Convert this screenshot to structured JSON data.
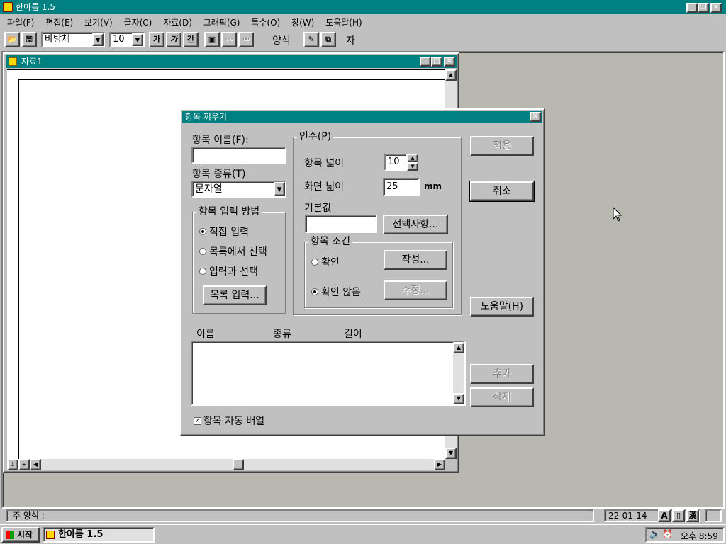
{
  "app": {
    "title": "한아름 1.5",
    "title_icon": "hanarum-app-icon",
    "menu": [
      "파일(F)",
      "편집(E)",
      "보기(V)",
      "글자(C)",
      "자료(D)",
      "그래픽(G)",
      "특수(O)",
      "창(W)",
      "도움말(H)"
    ]
  },
  "toolbar": {
    "font_name": "바탕체",
    "font_size": "10",
    "bold_label": "가",
    "italic_label": "가",
    "underline_label": "간",
    "style_label": "양식",
    "last_label": "자"
  },
  "doc_window": {
    "title": "자료1"
  },
  "dialog": {
    "title": "항목 끼우기",
    "item_name_label": "항목 이름(F):",
    "item_name_value": "",
    "item_type_label": "항목 종류(T)",
    "item_type_value": "문자열",
    "input_method": {
      "legend": "항목 입력 방법",
      "options": [
        "직접 입력",
        "목록에서 선택",
        "입력과 선택"
      ],
      "selected": "직접 입력",
      "list_button": "목록 입력..."
    },
    "args": {
      "legend": "인수(P)",
      "item_width_label": "항목 넓이",
      "item_width_value": "10",
      "screen_width_label": "화면 넓이",
      "screen_width_value": "25",
      "screen_width_unit": "mm",
      "default_label": "기본값",
      "default_value": "",
      "choices_button": "선택사항...",
      "condition": {
        "legend": "항목 조건",
        "confirm_label": "확인",
        "no_confirm_label": "확인 않음",
        "selected": "확인 않음",
        "create_button": "작성...",
        "edit_button": "수정..."
      }
    },
    "list": {
      "columns": [
        "이름",
        "종류",
        "길이"
      ],
      "rows": []
    },
    "auto_arrange_label": "항목 자동 배열",
    "auto_arrange_checked": true,
    "buttons": {
      "apply": "적용",
      "cancel": "취소",
      "help": "도움말(H)",
      "add": "추가",
      "delete": "삭제"
    }
  },
  "statusbar": {
    "style_text": "주 양식 :",
    "date": "22-01-14"
  },
  "taskbar": {
    "start_label": "시작",
    "task_label": "한아름 1.5",
    "clock": "오후 8:59"
  },
  "colors": {
    "titlebar": "#008080",
    "desktop": "#c0c0c0",
    "face": "#c0c0c0"
  }
}
